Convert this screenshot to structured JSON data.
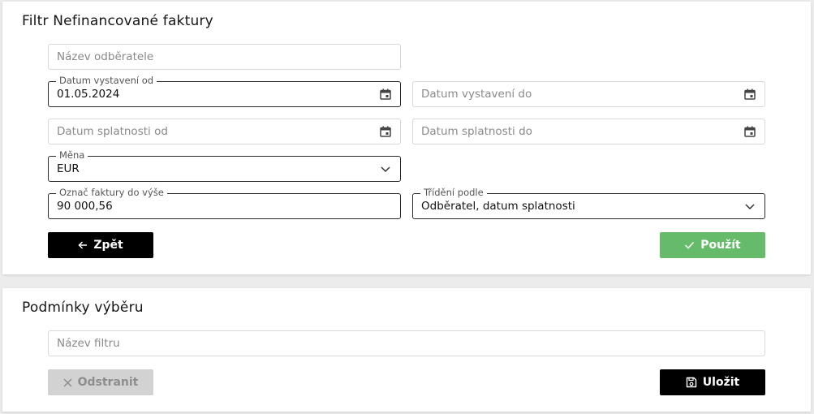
{
  "filter": {
    "title": "Filtr Nefinancované faktury",
    "customer_name": {
      "placeholder": "Název odběratele"
    },
    "issue_date_from": {
      "label": "Datum vystavení od",
      "value": "01.05.2024"
    },
    "issue_date_to": {
      "placeholder": "Datum vystavení do"
    },
    "due_date_from": {
      "placeholder": "Datum splatnosti od"
    },
    "due_date_to": {
      "placeholder": "Datum splatnosti do"
    },
    "currency": {
      "label": "Měna",
      "value": "EUR"
    },
    "amount_up_to": {
      "label": "Označ faktury do výše",
      "value": "90 000,56"
    },
    "sort_by": {
      "label": "Třídění podle",
      "value": "Odběratel, datum splatnosti"
    },
    "back_label": "Zpět",
    "apply_label": "Použít"
  },
  "conditions": {
    "title": "Podmínky výběru",
    "filter_name": {
      "placeholder": "Název filtru"
    },
    "delete_label": "Odstranit",
    "save_label": "Uložit"
  },
  "colors": {
    "primary": "#000000",
    "success": "#66bb6a",
    "disabled": "#d2d2d2"
  }
}
